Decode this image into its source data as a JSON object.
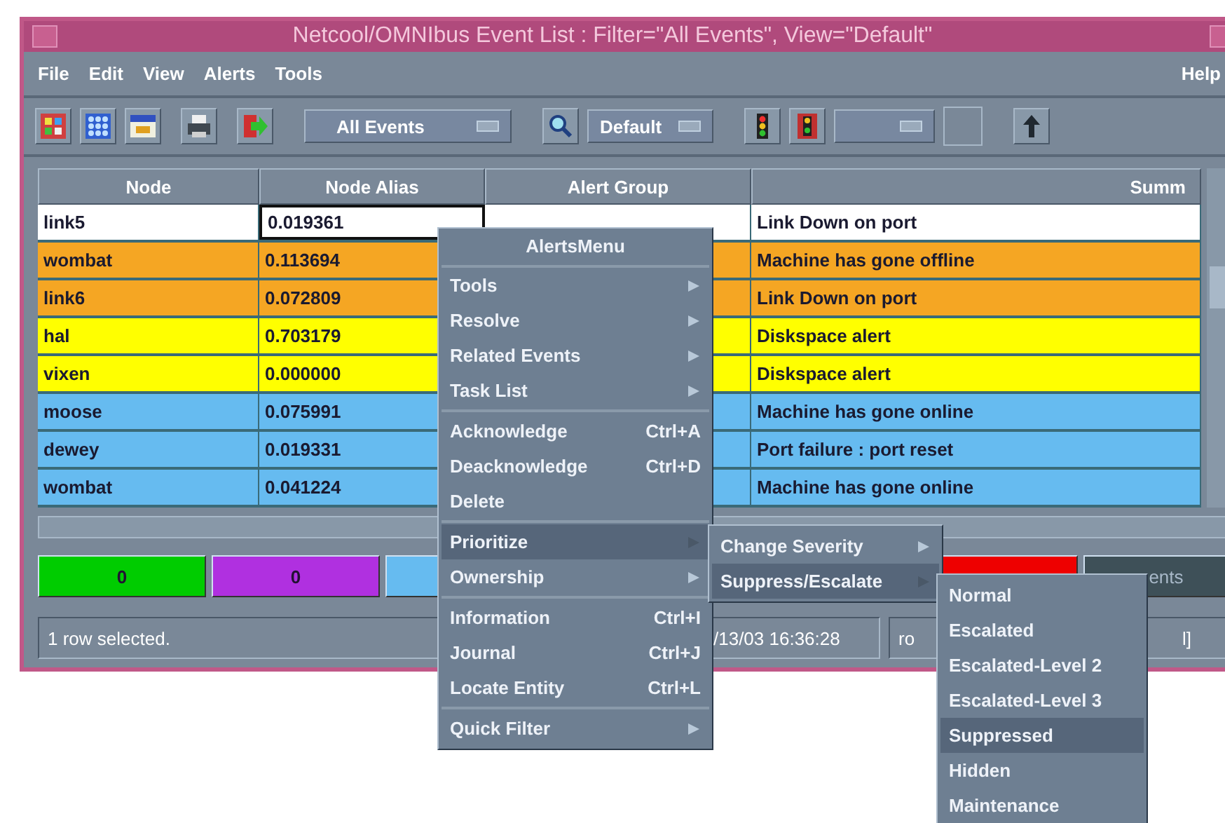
{
  "window": {
    "title": "Netcool/OMNIbus Event List : Filter=\"All Events\", View=\"Default\""
  },
  "menu_bar": {
    "left": [
      "File",
      "Edit",
      "View",
      "Alerts",
      "Tools"
    ],
    "right": "Help"
  },
  "toolbar": {
    "filter": "All Events",
    "view": "Default"
  },
  "table": {
    "columns": [
      "Node",
      "Node Alias",
      "Alert Group",
      "Summ"
    ],
    "rows": [
      {
        "node": "link5",
        "node_alias": "0.019361",
        "summary": "Link Down on port",
        "selected": true
      },
      {
        "node": "wombat",
        "node_alias": "0.113694",
        "summary": "Machine has gone offline",
        "selected": false,
        "color": "#f5a623"
      },
      {
        "node": "link6",
        "node_alias": "0.072809",
        "summary": "Link Down on port",
        "selected": false,
        "color": "#f5a623"
      },
      {
        "node": "hal",
        "node_alias": "0.703179",
        "summary": "Diskspace alert",
        "selected": false,
        "color": "#ffff00"
      },
      {
        "node": "vixen",
        "node_alias": "0.000000",
        "summary": "Diskspace alert",
        "selected": false,
        "color": "#ffff00"
      },
      {
        "node": "moose",
        "node_alias": "0.075991",
        "summary": "Machine has gone online",
        "selected": false,
        "color": "#66bbf0"
      },
      {
        "node": "dewey",
        "node_alias": "0.019331",
        "summary": "Port failure : port reset",
        "selected": false,
        "color": "#66bbf0"
      },
      {
        "node": "wombat",
        "node_alias": "0.041224",
        "summary": "Machine has gone online",
        "selected": false,
        "color": "#66bbf0"
      }
    ]
  },
  "filter_bar": [
    {
      "label": "0",
      "color": "#00cc00"
    },
    {
      "label": "0",
      "color": "#b030e0"
    },
    {
      "color": "#66bbf0"
    },
    {
      "color": "#ee0000"
    },
    {
      "label": "ents",
      "color": "#3e5058"
    }
  ],
  "status_bar": [
    "1 row selected.",
    "/13/03 16:36:28",
    "ro",
    "l]"
  ],
  "alerts_menu": {
    "title": "AlertsMenu",
    "items": [
      {
        "kind": "submenu",
        "label": "Tools",
        "selected": false
      },
      {
        "kind": "submenu",
        "label": "Resolve",
        "selected": false
      },
      {
        "kind": "submenu",
        "label": "Related Events",
        "selected": false
      },
      {
        "kind": "submenu",
        "label": "Task List",
        "selected": false
      },
      {
        "kind": "separator"
      },
      {
        "kind": "command",
        "label": "Acknowledge",
        "shortcut": "Ctrl+A",
        "selected": false
      },
      {
        "kind": "command",
        "label": "Deacknowledge",
        "shortcut": "Ctrl+D",
        "selected": false
      },
      {
        "kind": "command",
        "label": "Delete",
        "selected": false
      },
      {
        "kind": "separator"
      },
      {
        "kind": "submenu",
        "label": "Prioritize",
        "selected": true
      },
      {
        "kind": "submenu",
        "label": "Ownership",
        "selected": false
      },
      {
        "kind": "separator"
      },
      {
        "kind": "command",
        "label": "Information",
        "shortcut": "Ctrl+I",
        "selected": false
      },
      {
        "kind": "command",
        "label": "Journal",
        "shortcut": "Ctrl+J",
        "selected": false
      },
      {
        "kind": "command",
        "label": "Locate Entity",
        "shortcut": "Ctrl+L",
        "selected": false
      },
      {
        "kind": "separator"
      },
      {
        "kind": "submenu",
        "label": "Quick Filter",
        "selected": false
      }
    ]
  },
  "prioritize_menu": {
    "items": [
      {
        "kind": "submenu",
        "label": "Change Severity",
        "selected": false
      },
      {
        "kind": "submenu",
        "label": "Suppress/Escalate",
        "selected": true
      }
    ]
  },
  "suppress_menu": {
    "items": [
      {
        "kind": "command",
        "label": "Normal",
        "selected": false
      },
      {
        "kind": "command",
        "label": "Escalated",
        "selected": false
      },
      {
        "kind": "command",
        "label": "Escalated-Level 2",
        "selected": false
      },
      {
        "kind": "command",
        "label": "Escalated-Level 3",
        "selected": false
      },
      {
        "kind": "command",
        "label": "Suppressed",
        "selected": true
      },
      {
        "kind": "command",
        "label": "Hidden",
        "selected": false
      },
      {
        "kind": "command",
        "label": "Maintenance",
        "selected": false
      }
    ]
  }
}
